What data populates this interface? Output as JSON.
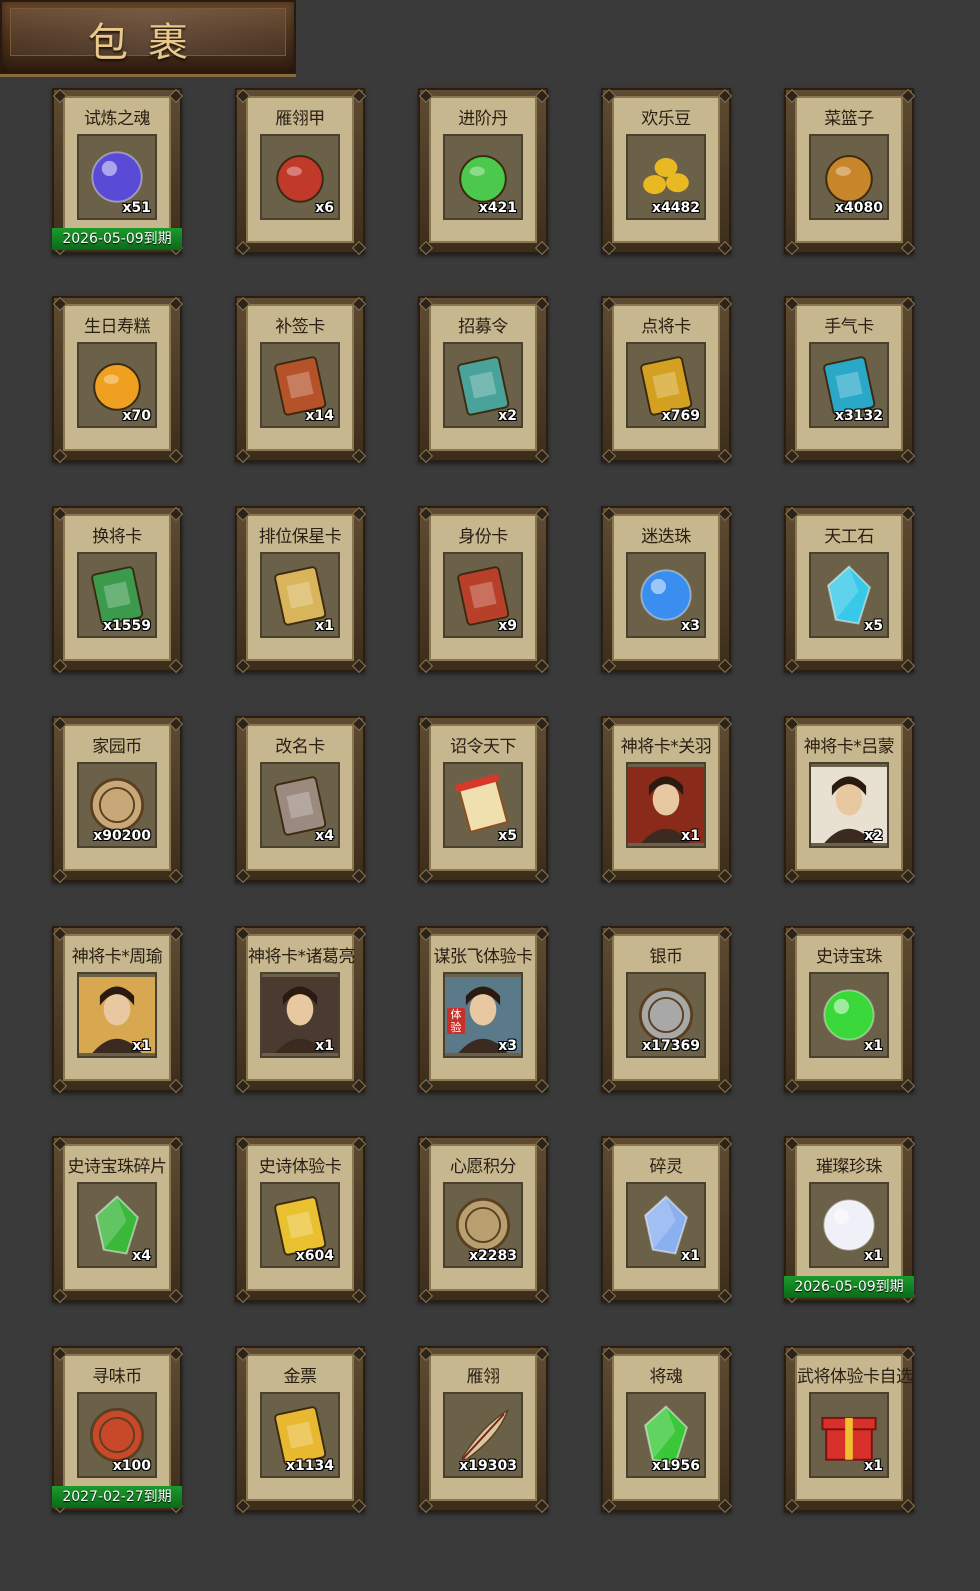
{
  "header": {
    "title": "包裹"
  },
  "items": [
    {
      "name": "试炼之魂",
      "qty": "x51",
      "expiry": "2026-05-09到期",
      "icon": "purple-dragon-orb-icon",
      "color": "#5a4bd6"
    },
    {
      "name": "雁翎甲",
      "qty": "x6",
      "icon": "armor-helmet-icon",
      "color": "#c0392b"
    },
    {
      "name": "进阶丹",
      "qty": "x421",
      "icon": "green-pill-icon",
      "color": "#4cc94c"
    },
    {
      "name": "欢乐豆",
      "qty": "x4482",
      "icon": "gold-beans-icon",
      "color": "#e8b923"
    },
    {
      "name": "菜篮子",
      "qty": "x4080",
      "icon": "basket-icon",
      "color": "#c8862a"
    },
    {
      "name": "生日寿糕",
      "qty": "x70",
      "icon": "cake-icon",
      "color": "#f0a020"
    },
    {
      "name": "补签卡",
      "qty": "x14",
      "icon": "sign-card-icon",
      "color": "#b5522a"
    },
    {
      "name": "招募令",
      "qty": "x2",
      "icon": "recruit-token-icon",
      "color": "#4aa39a"
    },
    {
      "name": "点将卡",
      "qty": "x769",
      "icon": "general-token-icon",
      "color": "#d4a021"
    },
    {
      "name": "手气卡",
      "qty": "x3132",
      "icon": "luck-card-icon",
      "color": "#2aa8c8"
    },
    {
      "name": "换将卡",
      "qty": "x1559",
      "icon": "swap-card-icon",
      "color": "#3c9a4c"
    },
    {
      "name": "排位保星卡",
      "qty": "x1",
      "icon": "star-shield-card-icon",
      "color": "#d8b45a"
    },
    {
      "name": "身份卡",
      "qty": "x9",
      "icon": "mask-card-icon",
      "color": "#b8402a"
    },
    {
      "name": "迷迭珠",
      "qty": "x3",
      "icon": "blue-orb-icon",
      "color": "#3a8ef0"
    },
    {
      "name": "天工石",
      "qty": "x5",
      "icon": "crystal-stone-icon",
      "color": "#38c8e8"
    },
    {
      "name": "家园币",
      "qty": "x90200",
      "icon": "home-coin-icon",
      "color": "#c8a878"
    },
    {
      "name": "改名卡",
      "qty": "x4",
      "icon": "rename-tag-icon",
      "color": "#9a8a80"
    },
    {
      "name": "诏令天下",
      "qty": "x5",
      "icon": "scroll-icon",
      "color": "#d8382a"
    },
    {
      "name": "神将卡*关羽",
      "qty": "x1",
      "icon": "guanyu-portrait-icon",
      "color": "#8a2a1a"
    },
    {
      "name": "神将卡*吕蒙",
      "qty": "x2",
      "icon": "lvmeng-portrait-icon",
      "color": "#e8e0d0"
    },
    {
      "name": "神将卡*周瑜",
      "qty": "x1",
      "icon": "zhouyu-portrait-icon",
      "color": "#d8a850"
    },
    {
      "name": "神将卡*诸葛亮",
      "qty": "x1",
      "icon": "zhugeliang-portrait-icon",
      "color": "#4a3a30"
    },
    {
      "name": "谋张飞体验卡",
      "qty": "x3",
      "badge": "体验",
      "icon": "zhangfei-portrait-icon",
      "color": "#5a7a8a"
    },
    {
      "name": "银币",
      "qty": "x17369",
      "icon": "silver-coins-icon",
      "color": "#a8a8a8"
    },
    {
      "name": "史诗宝珠",
      "qty": "x1",
      "icon": "green-orb-icon",
      "color": "#3ad83a"
    },
    {
      "name": "史诗宝珠碎片",
      "qty": "x4",
      "icon": "green-shard-icon",
      "color": "#3ab83a"
    },
    {
      "name": "史诗体验卡",
      "qty": "x604",
      "icon": "gold-card-icon",
      "color": "#e8c030"
    },
    {
      "name": "心愿积分",
      "qty": "x2283",
      "icon": "heart-coin-icon",
      "color": "#b8a070"
    },
    {
      "name": "碎灵",
      "qty": "x1",
      "icon": "spirit-crystal-icon",
      "color": "#8ab0f0"
    },
    {
      "name": "璀璨珍珠",
      "qty": "x1",
      "expiry": "2026-05-09到期",
      "icon": "pearl-icon",
      "color": "#f0f0f8"
    },
    {
      "name": "寻味币",
      "qty": "x100",
      "expiry": "2027-02-27到期",
      "icon": "taste-coin-icon",
      "color": "#c8482a"
    },
    {
      "name": "金票",
      "qty": "x1134",
      "icon": "gold-ticket-icon",
      "color": "#e8b830"
    },
    {
      "name": "雁翎",
      "qty": "x19303",
      "icon": "feather-icon",
      "color": "#d8c8a0"
    },
    {
      "name": "将魂",
      "qty": "x1956",
      "icon": "general-soul-icon",
      "color": "#3ac83a"
    },
    {
      "name": "武将体验卡自选",
      "qty": "x1",
      "icon": "gift-box-icon",
      "color": "#d8302a"
    }
  ]
}
